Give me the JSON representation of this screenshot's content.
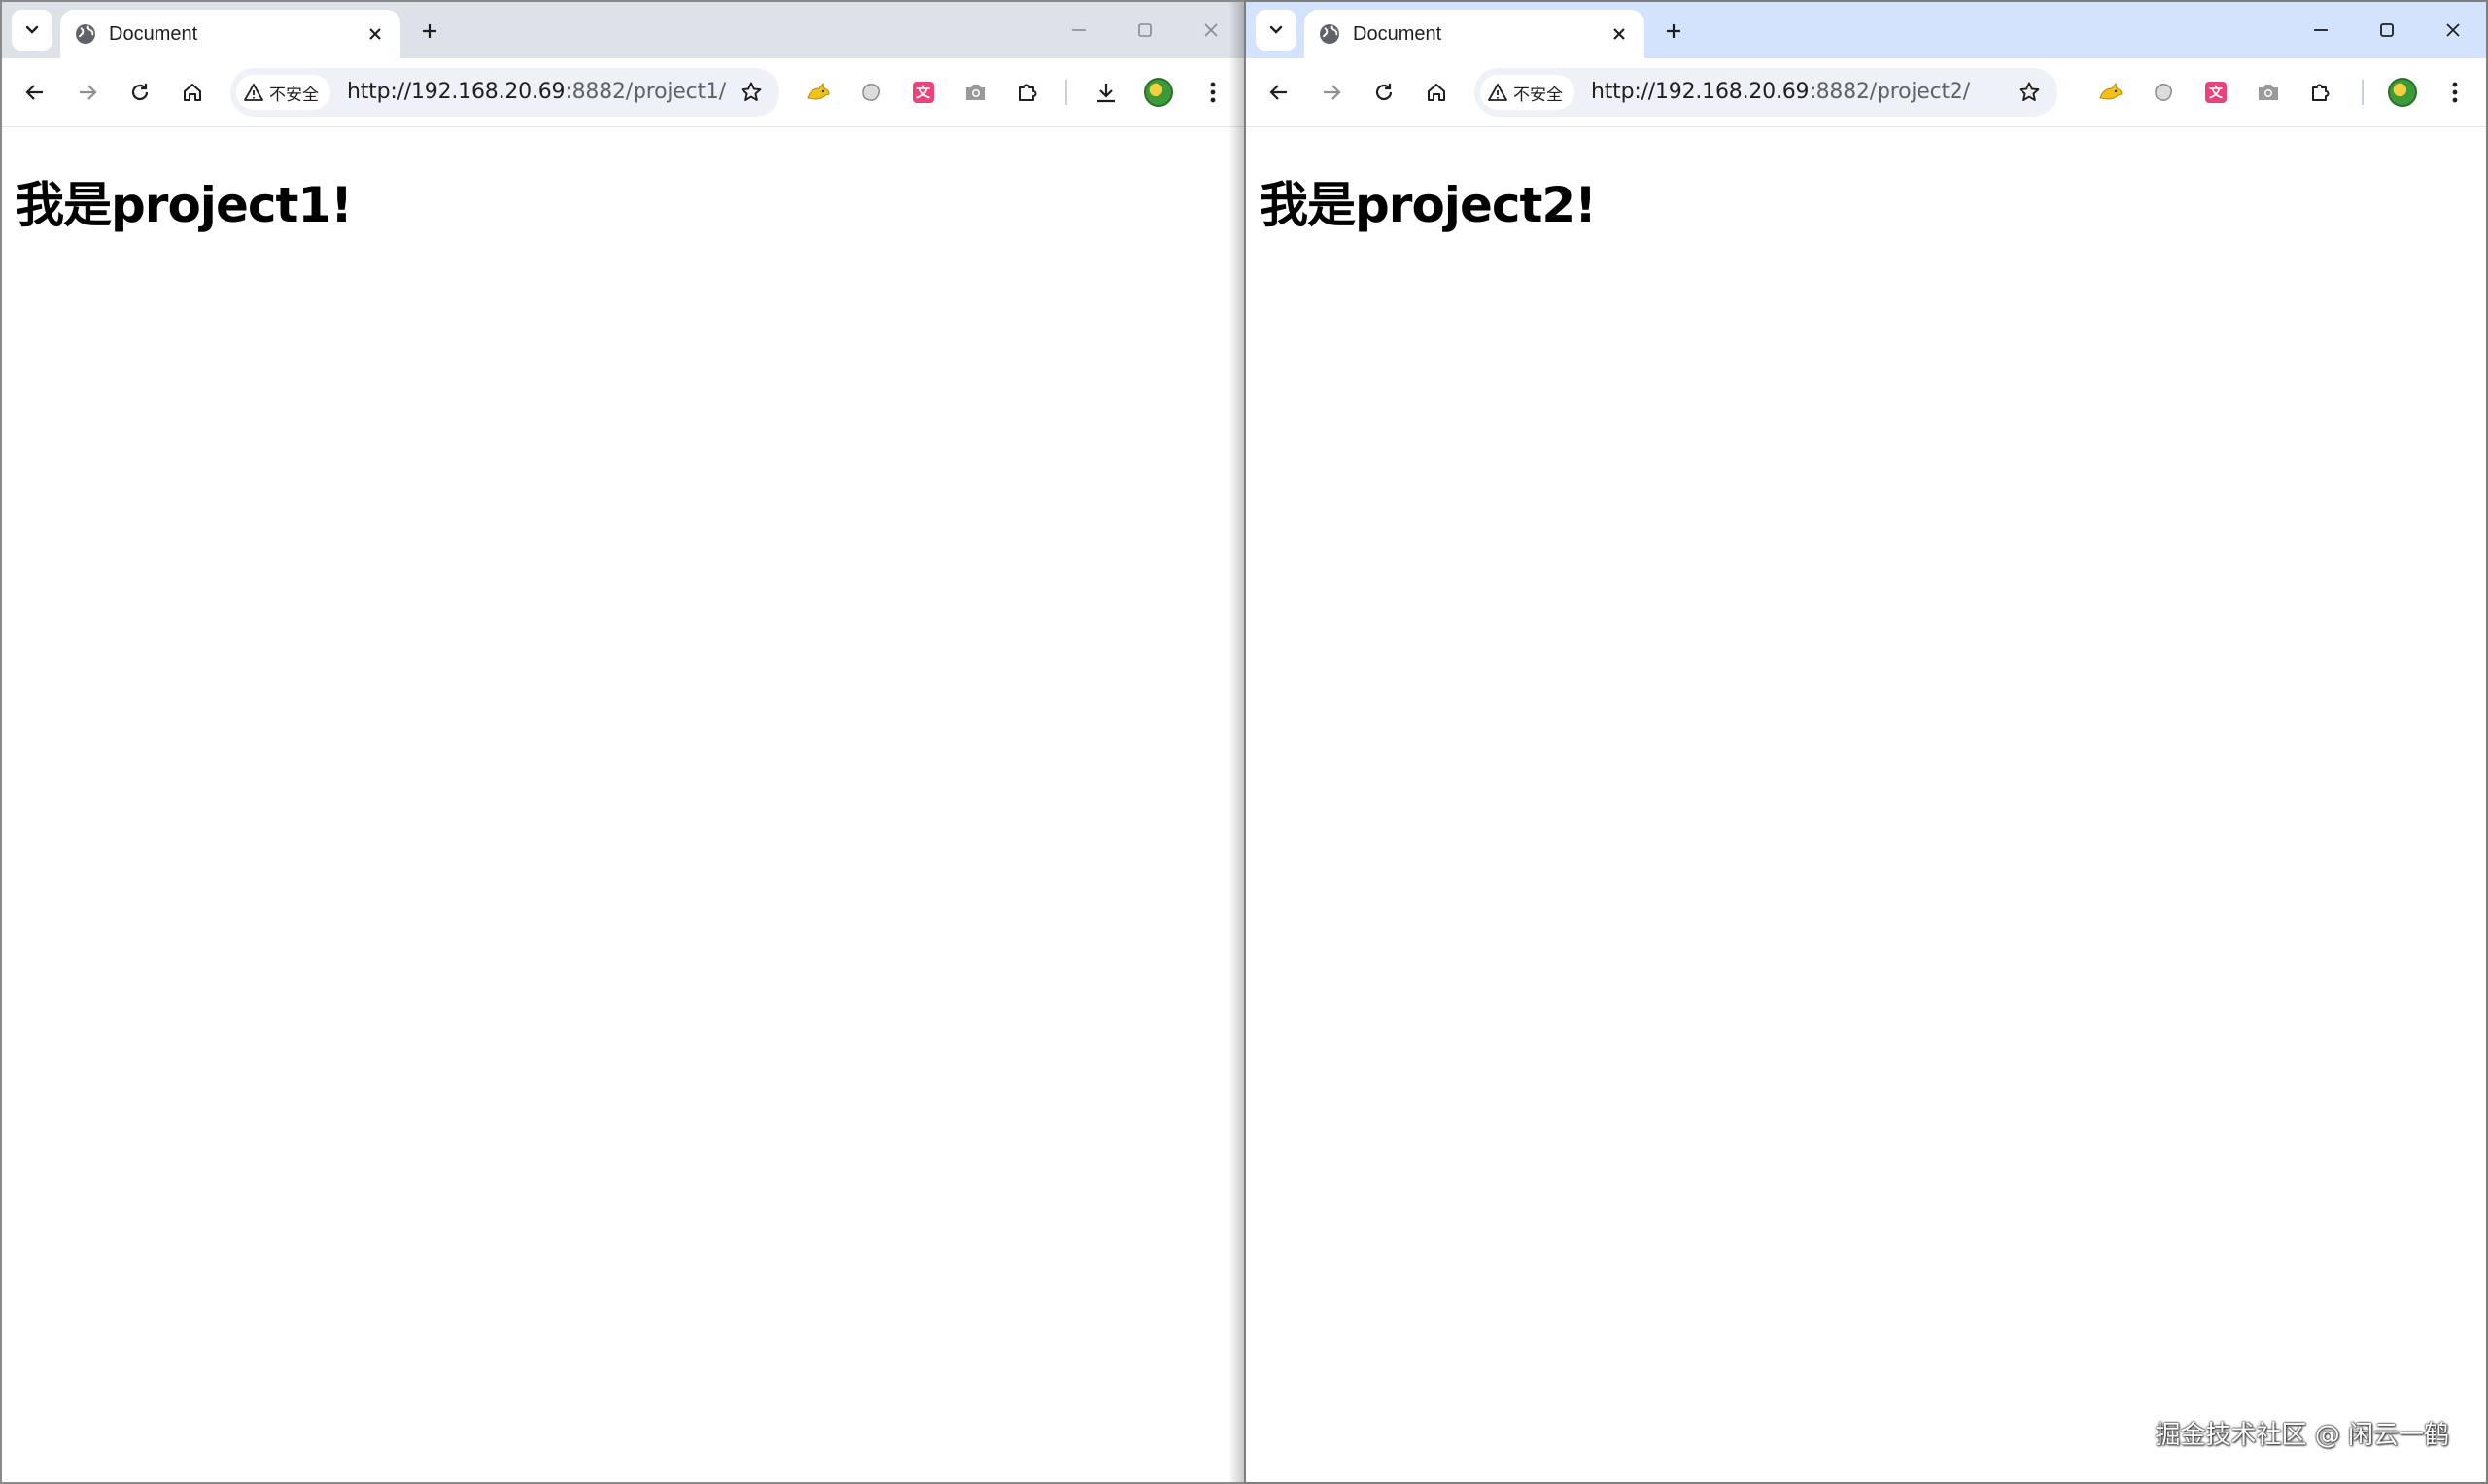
{
  "windows": [
    {
      "tab_title": "Document",
      "security_label": "不安全",
      "url_main": "http://192.168.20.69",
      "url_rest": ":8882/project1/",
      "heading": "我是project1!",
      "active": false
    },
    {
      "tab_title": "Document",
      "security_label": "不安全",
      "url_main": "http://192.168.20.69",
      "url_rest": ":8882/project2/",
      "heading": "我是project2!",
      "active": true
    }
  ],
  "watermark": "掘金技术社区 @ 闲云一鹤",
  "colors": {
    "inactive_tabstrip": "#dde2e9",
    "active_tabstrip": "#d3e3fd",
    "omnibox_bg": "#eef2f8"
  }
}
